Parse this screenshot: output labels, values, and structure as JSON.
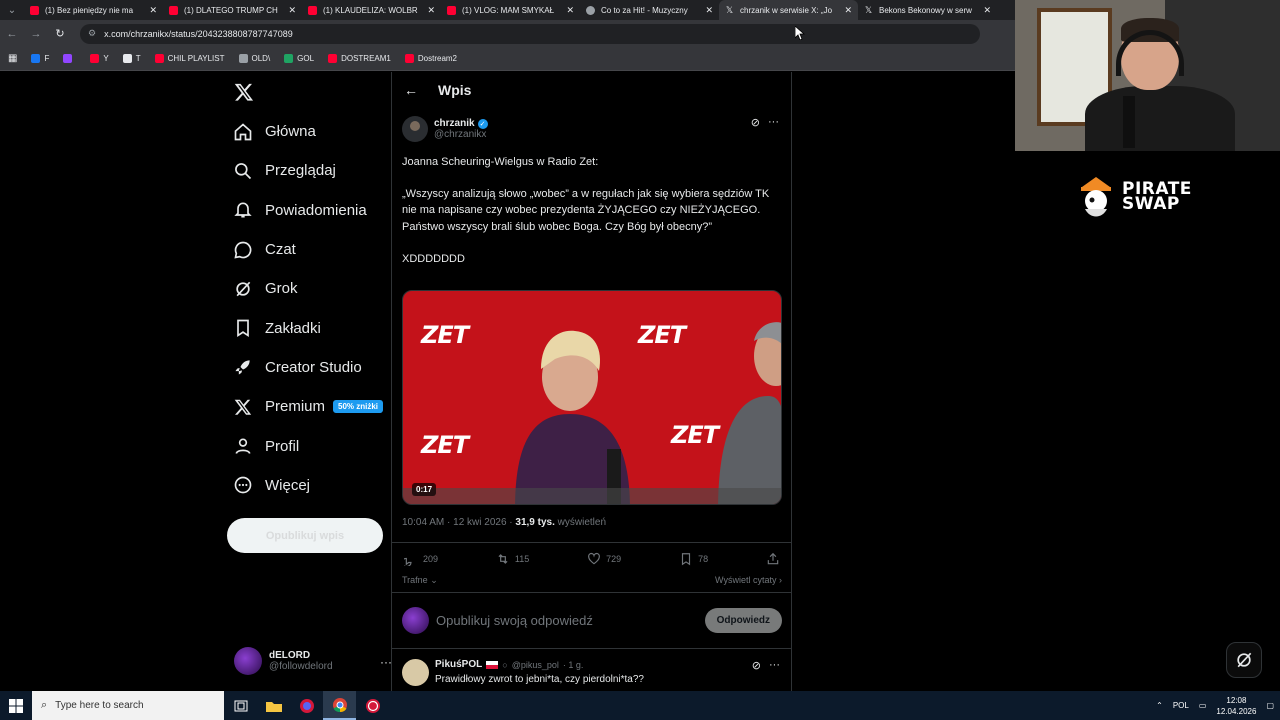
{
  "browser": {
    "tabs": [
      {
        "title": "(1) Bez pieniędzy nie ma",
        "icon": "youtube-icon",
        "active": false
      },
      {
        "title": "(1) DLATEGO TRUMP CH",
        "icon": "youtube-icon",
        "active": false
      },
      {
        "title": "(1) KLAUDELIZA: WOLBR",
        "icon": "youtube-icon",
        "active": false
      },
      {
        "title": "(1) VLOG: MAM SMYKAŁ",
        "icon": "youtube-icon",
        "active": false
      },
      {
        "title": "Co to za Hit! - Muzyczny",
        "icon": "globe-icon",
        "active": false
      },
      {
        "title": "chrzanik w serwisie X: „Jo",
        "icon": "x-icon",
        "active": true
      },
      {
        "title": "Bekons Bekonowy w serw",
        "icon": "x-icon",
        "active": false
      }
    ],
    "url": "x.com/chrzanikx/status/2043238808787747089",
    "bookmarks": [
      {
        "label": "F",
        "color": "#1877f2"
      },
      {
        "label": "",
        "color": "#9146ff"
      },
      {
        "label": "Y",
        "color": "#ff0033"
      },
      {
        "label": "T",
        "color": "#e8eaed"
      },
      {
        "label": "CHIL PLAYLIST",
        "color": "#ff0033"
      },
      {
        "label": "OLD\\",
        "color": "#9aa0a6"
      },
      {
        "label": "GOL",
        "color": "#1fa463"
      },
      {
        "label": "DOSTREAM1",
        "color": "#ff0033"
      },
      {
        "label": "Dostream2",
        "color": "#ff0033"
      }
    ]
  },
  "sidebar": {
    "items": [
      {
        "label": "Główna",
        "icon": "home-icon"
      },
      {
        "label": "Przeglądaj",
        "icon": "search-icon"
      },
      {
        "label": "Powiadomienia",
        "icon": "bell-icon"
      },
      {
        "label": "Czat",
        "icon": "chat-icon"
      },
      {
        "label": "Grok",
        "icon": "grok-icon"
      },
      {
        "label": "Zakładki",
        "icon": "bookmark-icon"
      },
      {
        "label": "Creator Studio",
        "icon": "rocket-icon"
      },
      {
        "label": "Premium",
        "icon": "x-premium-icon"
      },
      {
        "label": "Profil",
        "icon": "profile-icon"
      },
      {
        "label": "Więcej",
        "icon": "more-circle-icon"
      }
    ],
    "premium_badge": "50% zniżki",
    "post_button": "Opublikuj wpis",
    "account": {
      "name": "dELORD",
      "handle": "@followdelord"
    }
  },
  "post": {
    "header": "Wpis",
    "author_name": "chrzanik",
    "author_handle": "@chrzanikx",
    "lines": [
      "Joanna Scheuring-Wielgus w Radio Zet:",
      "",
      "„Wszyscy analizują słowo „wobec” a w regułach jak się wybiera sędziów TK nie ma napisane czy wobec prezydenta ŻYJĄCEGO czy NIEŻYJĄCEGO.",
      "Państwo wszyscy brali ślub wobec Boga. Czy Bóg był obecny?”",
      "",
      "XDDDDDDD"
    ],
    "video_duration": "0:17",
    "video_brand_text": "ZET",
    "timestamp": "10:04 AM · 12 kwi 2026 · ",
    "views_count": "31,9 tys.",
    "views_label": "wyświetleń",
    "stats": {
      "replies": "209",
      "reposts": "115",
      "likes": "729",
      "bookmarks": "78"
    },
    "sort_label": "Trafne",
    "quotes_label": "Wyświetl cytaty",
    "reply_placeholder": "Opublikuj swoją odpowiedź",
    "reply_button": "Odpowiedz"
  },
  "reply": {
    "name": "PikuśPOL",
    "handle": "@pikus_pol",
    "time": "· 1 g.",
    "text": "Prawidłowy zwrot to jebni*ta, czy pierdolni*ta??"
  },
  "overlay": {
    "brand_line1": "PIRATE",
    "brand_line2": "SWAP"
  },
  "taskbar": {
    "search_placeholder": "Type here to search",
    "lang": "POL",
    "time": "12:08",
    "date": "12.04.2026"
  }
}
